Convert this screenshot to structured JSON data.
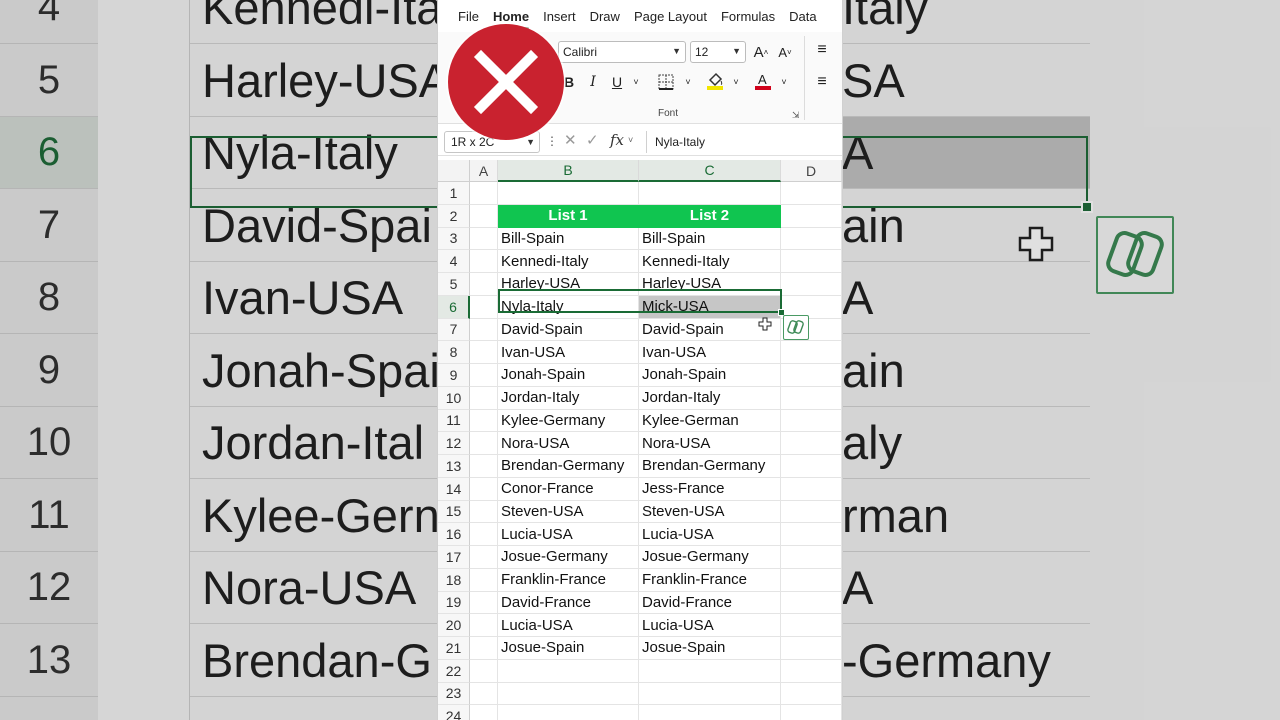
{
  "ribbon_tabs": [
    "File",
    "Home",
    "Insert",
    "Draw",
    "Page Layout",
    "Formulas",
    "Data"
  ],
  "active_tab": "Home",
  "font": {
    "name": "Calibri",
    "size": "12",
    "group_label": "Font"
  },
  "formula_bar": {
    "name_box": "1R x 2C",
    "fx_label": "fx",
    "value": "Nyla-Italy"
  },
  "columns": [
    "A",
    "B",
    "C",
    "D"
  ],
  "selected_columns": [
    "B",
    "C"
  ],
  "row_numbers": [
    "1",
    "2",
    "3",
    "4",
    "5",
    "6",
    "7",
    "8",
    "9",
    "10",
    "11",
    "12",
    "13",
    "14",
    "15",
    "16",
    "17",
    "18",
    "19",
    "20",
    "21",
    "22",
    "23",
    "24"
  ],
  "selected_row": "6",
  "headers": {
    "list1": "List 1",
    "list2": "List 2"
  },
  "list1": [
    "Bill-Spain",
    "Kennedi-Italy",
    "Harley-USA",
    "Nyla-Italy",
    "David-Spain",
    "Ivan-USA",
    "Jonah-Spain",
    "Jordan-Italy",
    "Kylee-Germany",
    "Nora-USA",
    "Brendan-Germany",
    "Conor-France",
    "Steven-USA",
    "Lucia-USA",
    "Josue-Germany",
    "Franklin-France",
    "David-France",
    "Lucia-USA",
    "Josue-Spain"
  ],
  "list2": [
    "Bill-Spain",
    "Kennedi-Italy",
    "Harley-USA",
    "Mick-USA",
    "David-Spain",
    "Ivan-USA",
    "Jonah-Spain",
    "Jordan-Italy",
    "Kylee-German",
    "Nora-USA",
    "Brendan-Germany",
    "Jess-France",
    "Steven-USA",
    "Lucia-USA",
    "Josue-Germany",
    "Franklin-France",
    "David-France",
    "Lucia-USA",
    "Josue-Spain"
  ],
  "highlighted_difference_rows": [
    6
  ],
  "background_zoom": {
    "row_numbers": [
      "4",
      "5",
      "6",
      "7",
      "8",
      "9",
      "10",
      "11",
      "12",
      "13"
    ],
    "left_cells": [
      "Kennedi-Ita",
      "Harley-USA",
      "Nyla-Italy",
      "David-Spai",
      "Ivan-USA",
      "Jonah-Spai",
      "Jordan-Ital",
      "Kylee-Gern",
      "Nora-USA",
      "Brendan-G"
    ],
    "right_cells": [
      "Italy",
      "SA",
      "A",
      "ain",
      "A",
      "ain",
      "aly",
      "rman",
      "A",
      "-Germany"
    ]
  },
  "icons": {
    "status_badge": "error-x-icon",
    "grow_font": "increase-font-icon",
    "shrink_font": "decrease-font-icon",
    "copilot": "copilot-icon",
    "cursor": "cell-cursor-plus-icon"
  },
  "colors": {
    "header_green": "#10c550",
    "selection_green": "#1a6b35",
    "error_red": "#c9222f",
    "diff_gray": "#c6c6c6"
  }
}
